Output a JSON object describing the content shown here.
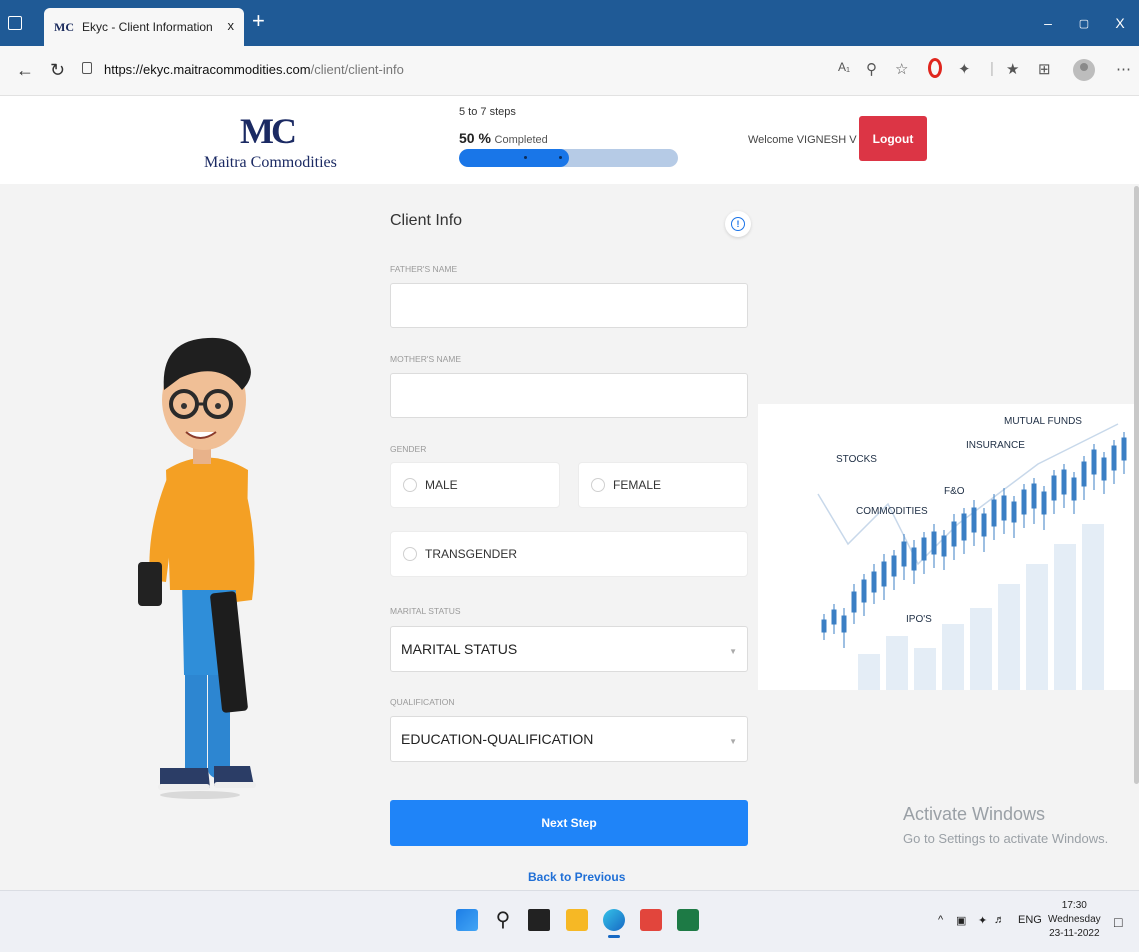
{
  "browser": {
    "tab_title": "Ekyc - Client Information",
    "tab_favicon_text": "MC",
    "url_host": "https://ekyc.maitracommodities.com",
    "url_path": "/client/client-info",
    "window_controls": {
      "minimize": "–",
      "restore": "▢",
      "close": "X"
    }
  },
  "header": {
    "logo_mark": "MC",
    "logo_text": "Maitra Commodities",
    "steps_text": "5 to 7 steps",
    "percent_value": "50 %",
    "percent_suffix": "Completed",
    "progress_fraction": 0.5,
    "welcome_text": "Welcome VIGNESH V",
    "logout_label": "Logout"
  },
  "form": {
    "title": "Client Info",
    "fathers_name_label": "FATHER'S NAME",
    "fathers_name_value": "",
    "mothers_name_label": "MOTHER'S NAME",
    "mothers_name_value": "",
    "gender_label": "GENDER",
    "gender_options": [
      "MALE",
      "FEMALE",
      "TRANSGENDER"
    ],
    "marital_status_label": "MARITAL STATUS",
    "marital_status_value": "MARITAL STATUS",
    "qualification_label": "QUALIFICATION",
    "qualification_value": "EDUCATION-QUALIFICATION",
    "next_label": "Next Step",
    "back_label": "Back to Previous"
  },
  "market_image": {
    "labels": [
      "STOCKS",
      "COMMODITIES",
      "F&O",
      "INSURANCE",
      "MUTUAL FUNDS",
      "IPO'S"
    ]
  },
  "watermark": {
    "line1": "Activate Windows",
    "line2": "Go to Settings to activate Windows."
  },
  "taskbar": {
    "tray_chevron": "^",
    "language": "ENG",
    "time": "17:30",
    "day": "Wednesday",
    "date": "23-11-2022"
  }
}
